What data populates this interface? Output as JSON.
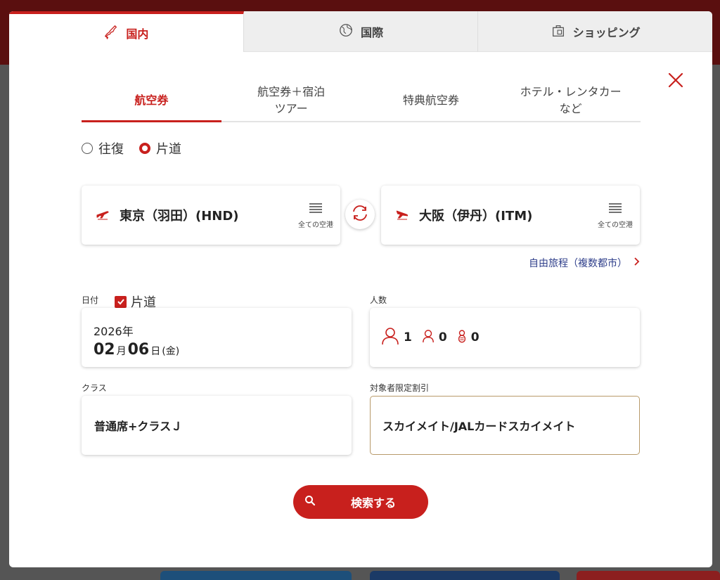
{
  "top_tabs": [
    {
      "label": "国内",
      "icon": "japan-map-icon"
    },
    {
      "label": "国際",
      "icon": "globe-icon"
    },
    {
      "label": "ショッピング",
      "icon": "shopping-bag-icon"
    }
  ],
  "sub_tabs": [
    {
      "label": "航空券"
    },
    {
      "label": "航空券＋宿泊\nツアー"
    },
    {
      "label": "特典航空券"
    },
    {
      "label": "ホテル・レンタカー\nなど"
    }
  ],
  "trip_type": {
    "round_trip": "往復",
    "one_way": "片道",
    "selected": "one_way"
  },
  "from_airport": {
    "name": "東京（羽田）(HND)",
    "all_airports_label": "全ての空港"
  },
  "to_airport": {
    "name": "大阪（伊丹）(ITM)",
    "all_airports_label": "全ての空港"
  },
  "multi_city_link": "自由旅程（複数都市）",
  "date": {
    "label": "日付",
    "oneway_label": "片道",
    "oneway_checked": true,
    "year": "2026年",
    "month": "02",
    "month_unit": "月",
    "day": "06",
    "day_unit": "日",
    "weekday": "(金)"
  },
  "passengers": {
    "label": "人数",
    "adults": "1",
    "children": "0",
    "infants": "0"
  },
  "class": {
    "label": "クラス",
    "value": "普通席+クラスＪ"
  },
  "discount": {
    "label": "対象者限定割引",
    "value": "スカイメイト/JALカードスカイメイト"
  },
  "search_button": "検索する",
  "colors": {
    "accent": "#c8201d",
    "link": "#2e3e8a",
    "discount_border": "#b89a6a"
  }
}
